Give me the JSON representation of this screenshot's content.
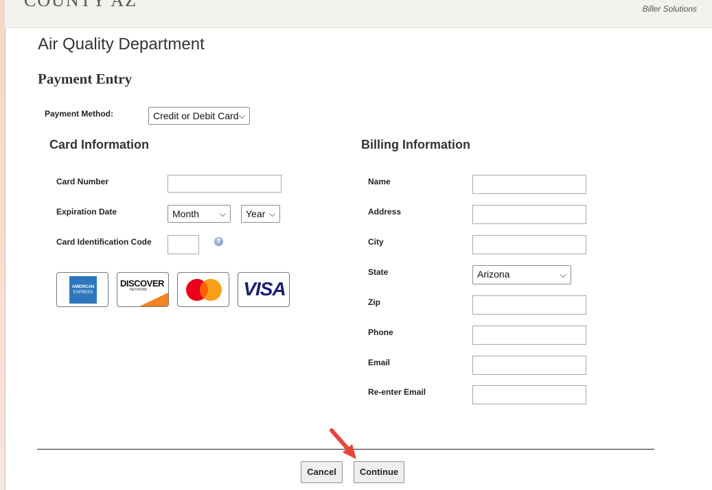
{
  "header": {
    "logo_text": "COUNTY AZ",
    "biller_text": "Biller Solutions"
  },
  "page": {
    "department": "Air Quality Department",
    "heading": "Payment Entry"
  },
  "payment_method": {
    "label": "Payment Method:",
    "value": "Credit or Debit Card"
  },
  "card_info": {
    "title": "Card Information",
    "card_number_label": "Card Number",
    "expiration_label": "Expiration Date",
    "month_value": "Month",
    "year_value": "Year",
    "cic_label": "Card Identification Code",
    "help_icon": "?",
    "cards": {
      "amex_line1": "AMERICAN",
      "amex_line2": "EXPRESS",
      "discover_text": "DISCOVER",
      "discover_sub": "NETWORK",
      "visa_text": "VISA"
    }
  },
  "billing_info": {
    "title": "Billing Information",
    "name_label": "Name",
    "address_label": "Address",
    "city_label": "City",
    "state_label": "State",
    "state_value": "Arizona",
    "zip_label": "Zip",
    "phone_label": "Phone",
    "email_label": "Email",
    "reenter_email_label": "Re-enter Email"
  },
  "actions": {
    "cancel_label": "Cancel",
    "continue_label": "Continue"
  },
  "colors": {
    "arrow": "#e8453c",
    "mastercard_red": "#eb001b",
    "mastercard_orange": "#f79e1b",
    "visa_blue": "#1a1f71",
    "amex_blue": "#2e77bc",
    "discover_orange": "#f58220"
  }
}
